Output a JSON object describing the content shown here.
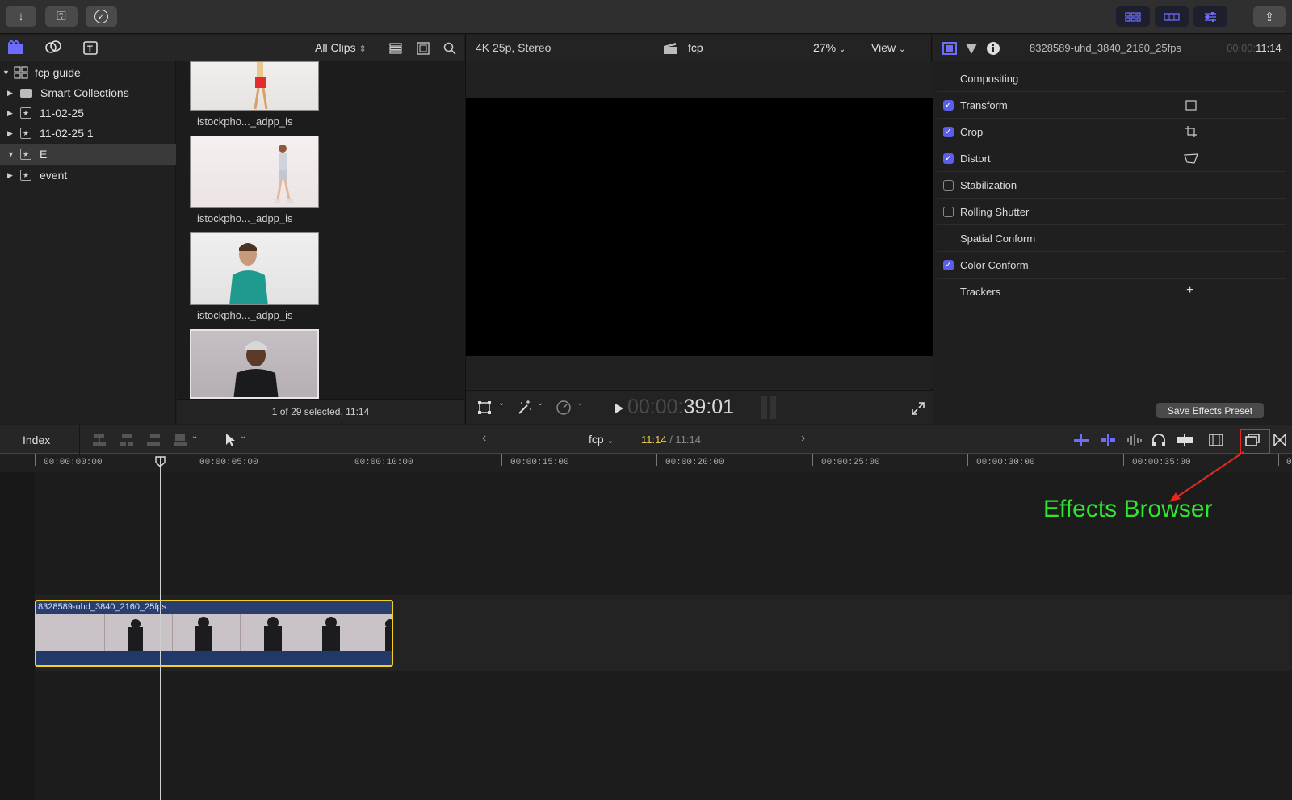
{
  "toolbar": {
    "import_icon": "↓",
    "keyword_icon": "⚿",
    "check_icon": "✓",
    "share_icon": "⇪"
  },
  "browser": {
    "filter": "All Clips",
    "library": {
      "name": "fcp guide",
      "items": [
        {
          "label": "Smart Collections",
          "icon": "folder-icon"
        },
        {
          "label": "11-02-25",
          "icon": "event-star-icon"
        },
        {
          "label": "11-02-25 1",
          "icon": "event-star-icon"
        },
        {
          "label": "E",
          "icon": "event-star-icon",
          "selected": true
        },
        {
          "label": "event",
          "icon": "event-star-icon"
        }
      ]
    },
    "clips": [
      {
        "label": "istockpho..._adpp_is"
      },
      {
        "label": "istockpho..._adpp_is"
      },
      {
        "label": "istockpho..._adpp_is"
      }
    ],
    "selection_status": "1 of 29 selected, 11:14"
  },
  "viewer": {
    "format": "4K 25p, Stereo",
    "project": "fcp",
    "zoom": "27%",
    "view_label": "View",
    "timecode_dim": "00:00:",
    "timecode_main": "39:01"
  },
  "inspector": {
    "clip_name": "8328589-uhd_3840_2160_25fps",
    "duration_dim": "00:00:",
    "duration": "11:14",
    "rows": [
      {
        "label": "Compositing",
        "check": "none"
      },
      {
        "label": "Transform",
        "check": "on"
      },
      {
        "label": "Crop",
        "check": "on"
      },
      {
        "label": "Distort",
        "check": "on"
      },
      {
        "label": "Stabilization",
        "check": "off"
      },
      {
        "label": "Rolling Shutter",
        "check": "off"
      },
      {
        "label": "Spatial Conform",
        "check": "none"
      },
      {
        "label": "Color Conform",
        "check": "on"
      },
      {
        "label": "Trackers",
        "check": "none"
      }
    ],
    "add_symbol": "+",
    "save_preset": "Save Effects Preset"
  },
  "timeline": {
    "index_label": "Index",
    "project": "fcp",
    "time_current": "11:14",
    "time_total": "/ 11:14",
    "ruler": [
      "00:00:00:00",
      "00:00:05:00",
      "00:00:10:00",
      "00:00:15:00",
      "00:00:20:00",
      "00:00:25:00",
      "00:00:30:00",
      "00:00:35:00",
      "0"
    ],
    "clip_name": "8328589-uhd_3840_2160_25fps"
  },
  "annotation": {
    "label": "Effects Browser",
    "color": "#2ee62e",
    "highlight_color": "#e8281c"
  }
}
